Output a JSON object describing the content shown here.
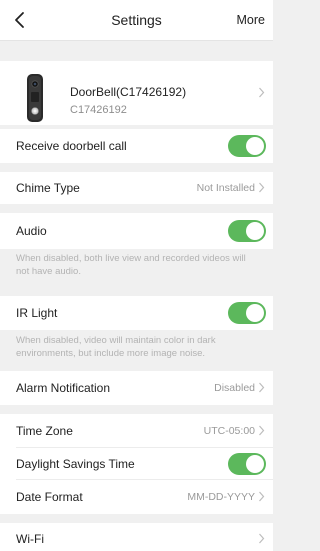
{
  "header": {
    "title": "Settings",
    "more_label": "More"
  },
  "device": {
    "name": "DoorBell(C17426192)",
    "serial": "C17426192"
  },
  "rows": {
    "receive_call": {
      "label": "Receive doorbell call",
      "on": true
    },
    "chime": {
      "label": "Chime Type",
      "value": "Not Installed"
    },
    "audio": {
      "label": "Audio",
      "on": true,
      "note": "When disabled, both live view and recorded videos will not have audio."
    },
    "ir": {
      "label": "IR Light",
      "on": true,
      "note": "When disabled, video will maintain color in dark environments, but include more image noise."
    },
    "alarm": {
      "label": "Alarm Notification",
      "value": "Disabled"
    },
    "timezone": {
      "label": "Time Zone",
      "value": "UTC-05:00"
    },
    "dst": {
      "label": "Daylight Savings Time",
      "on": true
    },
    "date_format": {
      "label": "Date Format",
      "value": "MM-DD-YYYY"
    },
    "wifi": {
      "label": "Wi-Fi"
    }
  },
  "colors": {
    "toggle_on": "#5cb85c",
    "background": "#f0f0f0"
  }
}
